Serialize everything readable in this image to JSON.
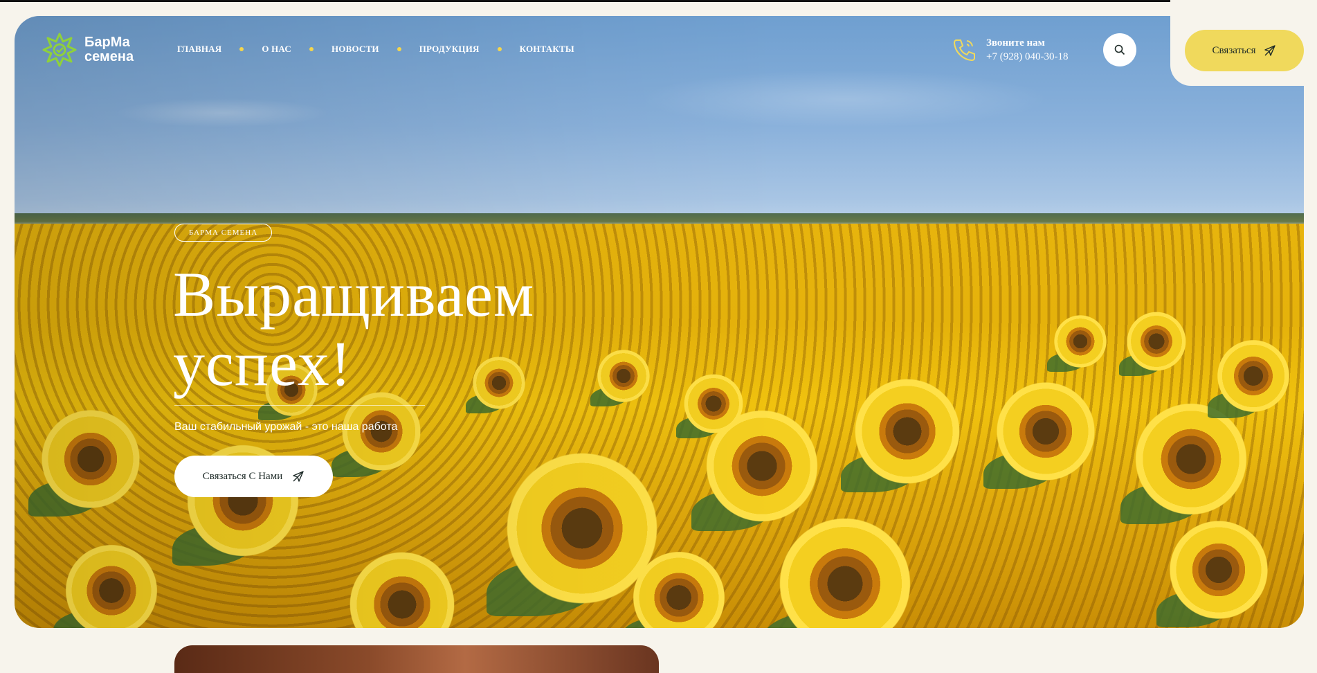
{
  "brand": {
    "line1": "БарМа",
    "line2": "семена",
    "logo_color": "#8fd13b"
  },
  "nav": {
    "items": [
      "ГЛАВНАЯ",
      "О НАС",
      "НОВОСТИ",
      "ПРОДУКЦИЯ",
      "КОНТАКТЫ"
    ],
    "dot_color": "#f5d64b"
  },
  "phone": {
    "caption": "Звоните нам",
    "number": "+7 (928) 040-30-18",
    "icon": "phone-icon"
  },
  "header": {
    "search_icon": "search-icon",
    "cta_label": "Связаться",
    "cta_color": "#f0d95c"
  },
  "hero": {
    "badge": "БАРМА СЕМЕНА",
    "headline_line1": "Выращиваем",
    "headline_line2": "успех!",
    "subtitle": "Ваш стабильный урожай - это наша работа",
    "cta_label": "Связаться С Нами",
    "background": "sunflower-field-photo"
  },
  "colors": {
    "page_bg": "#f7f4ec",
    "accent_yellow": "#f0d95c",
    "text_dark": "#1d2a27"
  }
}
